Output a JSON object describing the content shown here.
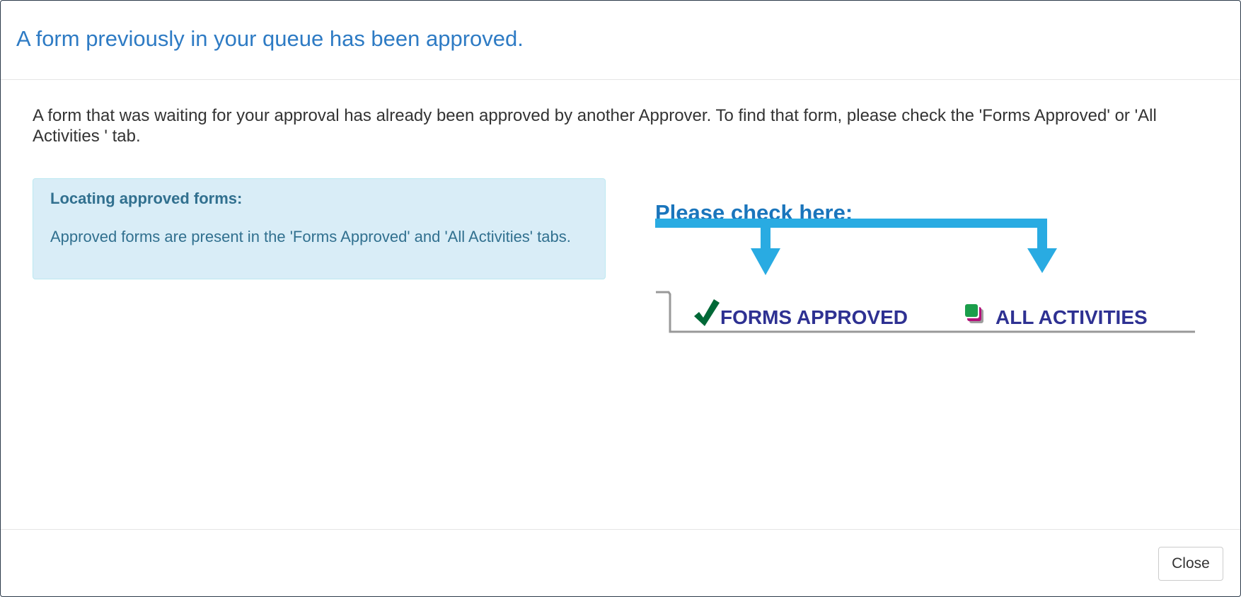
{
  "dialog": {
    "title": "A form previously in your queue has been approved.",
    "intro_text": "A form that was waiting for your approval has already been approved by another Approver. To find that form, please check the 'Forms Approved' or 'All Activities ' tab.",
    "info_box": {
      "heading": "Locating approved forms:",
      "text": "Approved forms are present in the 'Forms Approved' and 'All Activities' tabs."
    },
    "illustration": {
      "heading": "Please check here:",
      "tab_forms_approved": "FORMS APPROVED",
      "tab_all_activities": "ALL ACTIVITIES",
      "forms_icon": "checkmark-icon",
      "activities_icon": "stacked-squares-icon",
      "arrow_color": "#29abe2",
      "heading_color": "#1a75bc",
      "tab_text_color": "#2e3192",
      "check_color": "#006837"
    },
    "close_label": "Close"
  },
  "colors": {
    "title": "#2e7bc4",
    "info_bg": "#d9edf7",
    "info_text": "#31708f"
  }
}
